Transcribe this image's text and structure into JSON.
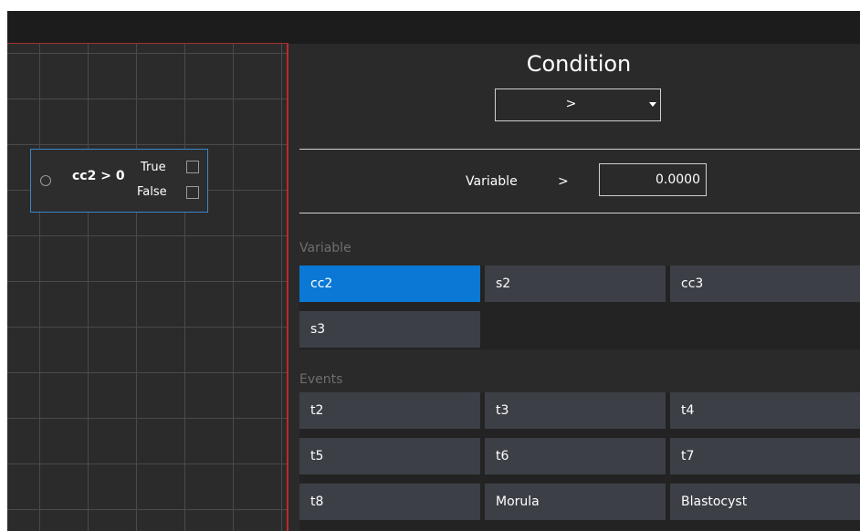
{
  "colors": {
    "selected": "#0a78d4",
    "button": "#3c3f46",
    "canvas_border": "#c0282c",
    "node_border": "#3a86c9"
  },
  "node": {
    "expression": "cc2 > 0",
    "true_label": "True",
    "false_label": "False"
  },
  "condition": {
    "title": "Condition",
    "selected_operator": ">"
  },
  "rule": {
    "variable_label": "Variable",
    "operator": ">",
    "value": "0.0000"
  },
  "variables": {
    "section_label": "Variable",
    "items": [
      {
        "label": "cc2",
        "selected": true
      },
      {
        "label": "s2",
        "selected": false
      },
      {
        "label": "cc3",
        "selected": false
      },
      {
        "label": "s3",
        "selected": false
      }
    ]
  },
  "events": {
    "section_label": "Events",
    "items": [
      {
        "label": "t2"
      },
      {
        "label": "t3"
      },
      {
        "label": "t4"
      },
      {
        "label": "t5"
      },
      {
        "label": "t6"
      },
      {
        "label": "t7"
      },
      {
        "label": "t8"
      },
      {
        "label": "Morula"
      },
      {
        "label": "Blastocyst"
      }
    ]
  }
}
